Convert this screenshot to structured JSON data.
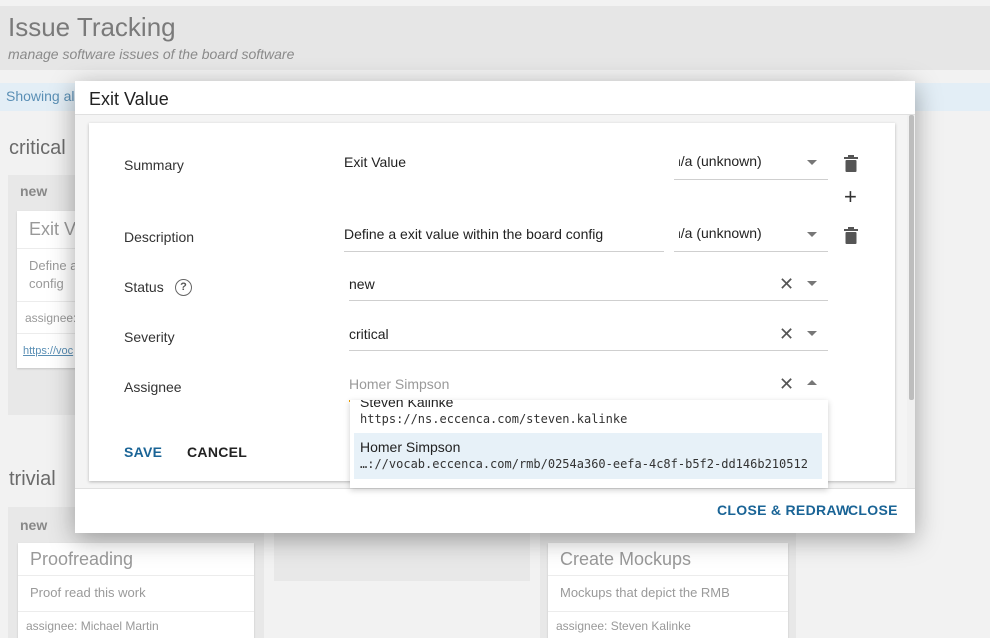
{
  "page": {
    "title": "Issue Tracking",
    "subtitle": "manage software issues of the board software",
    "info": "Showing al"
  },
  "board": {
    "critical": {
      "title": "critical",
      "columns": [
        {
          "title": "new",
          "cards": [
            {
              "title": "Exit V",
              "desc_line1": "Define a",
              "desc_line2": "config",
              "assignee": "assignee:",
              "link": "https://voc"
            }
          ]
        }
      ]
    },
    "trivial": {
      "title": "trivial",
      "columns": [
        {
          "title": "new",
          "cards": [
            {
              "title": "Proofreading",
              "desc": "Proof read this work",
              "assignee": "assignee: Michael Martin"
            }
          ]
        },
        {
          "title": "",
          "cards": []
        },
        {
          "title": "",
          "cards": [
            {
              "title": "Create Mockups",
              "desc": "Mockups that depict the RMB",
              "assignee": "assignee: Steven Kalinke"
            }
          ]
        }
      ]
    }
  },
  "dialog": {
    "title": "Exit Value",
    "fields": {
      "summary": {
        "label": "Summary",
        "value": "Exit Value",
        "language": "n/a (unknown)"
      },
      "description": {
        "label": "Description",
        "value": "Define a exit value within the board config",
        "language": "n/a (unknown)"
      },
      "status": {
        "label": "Status",
        "help": "?",
        "value": "new"
      },
      "severity": {
        "label": "Severity",
        "value": "critical"
      },
      "assignee": {
        "label": "Assignee",
        "placeholder": "Homer Simpson"
      }
    },
    "dropdown": {
      "options": [
        {
          "name": "Steven Kalinke",
          "uri": "https://ns.eccenca.com/steven.kalinke"
        },
        {
          "name": "Homer Simpson",
          "uri": "…://vocab.eccenca.com/rmb/0254a360-eefa-4c8f-b5f2-dd146b210512",
          "highlighted": true
        }
      ]
    },
    "actions": {
      "save": "SAVE",
      "cancel": "CANCEL"
    },
    "footer": {
      "close_redraw": "CLOSE & REDRAW",
      "close": "CLOSE"
    }
  },
  "colors": {
    "primary": "#1a6496",
    "link": "#5a8fb5",
    "focus": "#f0a000"
  }
}
